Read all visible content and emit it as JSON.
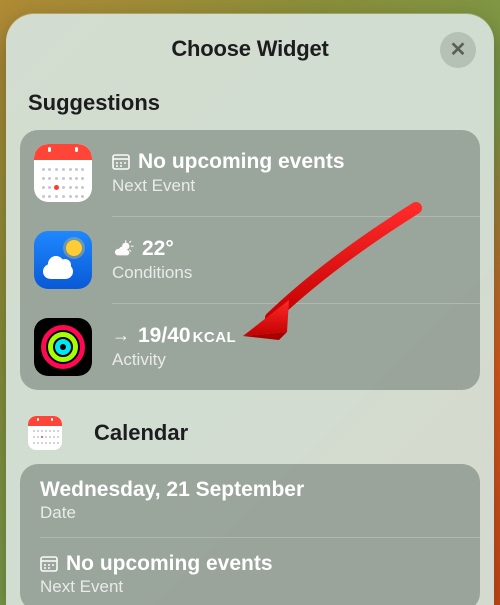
{
  "header": {
    "title": "Choose Widget",
    "close_glyph": "✕"
  },
  "sections": {
    "suggestions": {
      "title": "Suggestions",
      "rows": {
        "nextEvent": {
          "glyph": "calendar-grid",
          "primary": "No upcoming events",
          "secondary": "Next Event"
        },
        "conditions": {
          "glyph": "weather-partly",
          "temperature": "22°",
          "secondary": "Conditions"
        },
        "activity": {
          "arrow_glyph": "→",
          "value": "19/40",
          "unit": "KCAL",
          "secondary": "Activity"
        }
      }
    },
    "calendar": {
      "title": "Calendar",
      "rows": {
        "date": {
          "primary": "Wednesday, 21 September",
          "secondary": "Date"
        },
        "nextEvent": {
          "glyph": "calendar-grid",
          "primary": "No upcoming events",
          "secondary": "Next Event"
        }
      }
    }
  }
}
